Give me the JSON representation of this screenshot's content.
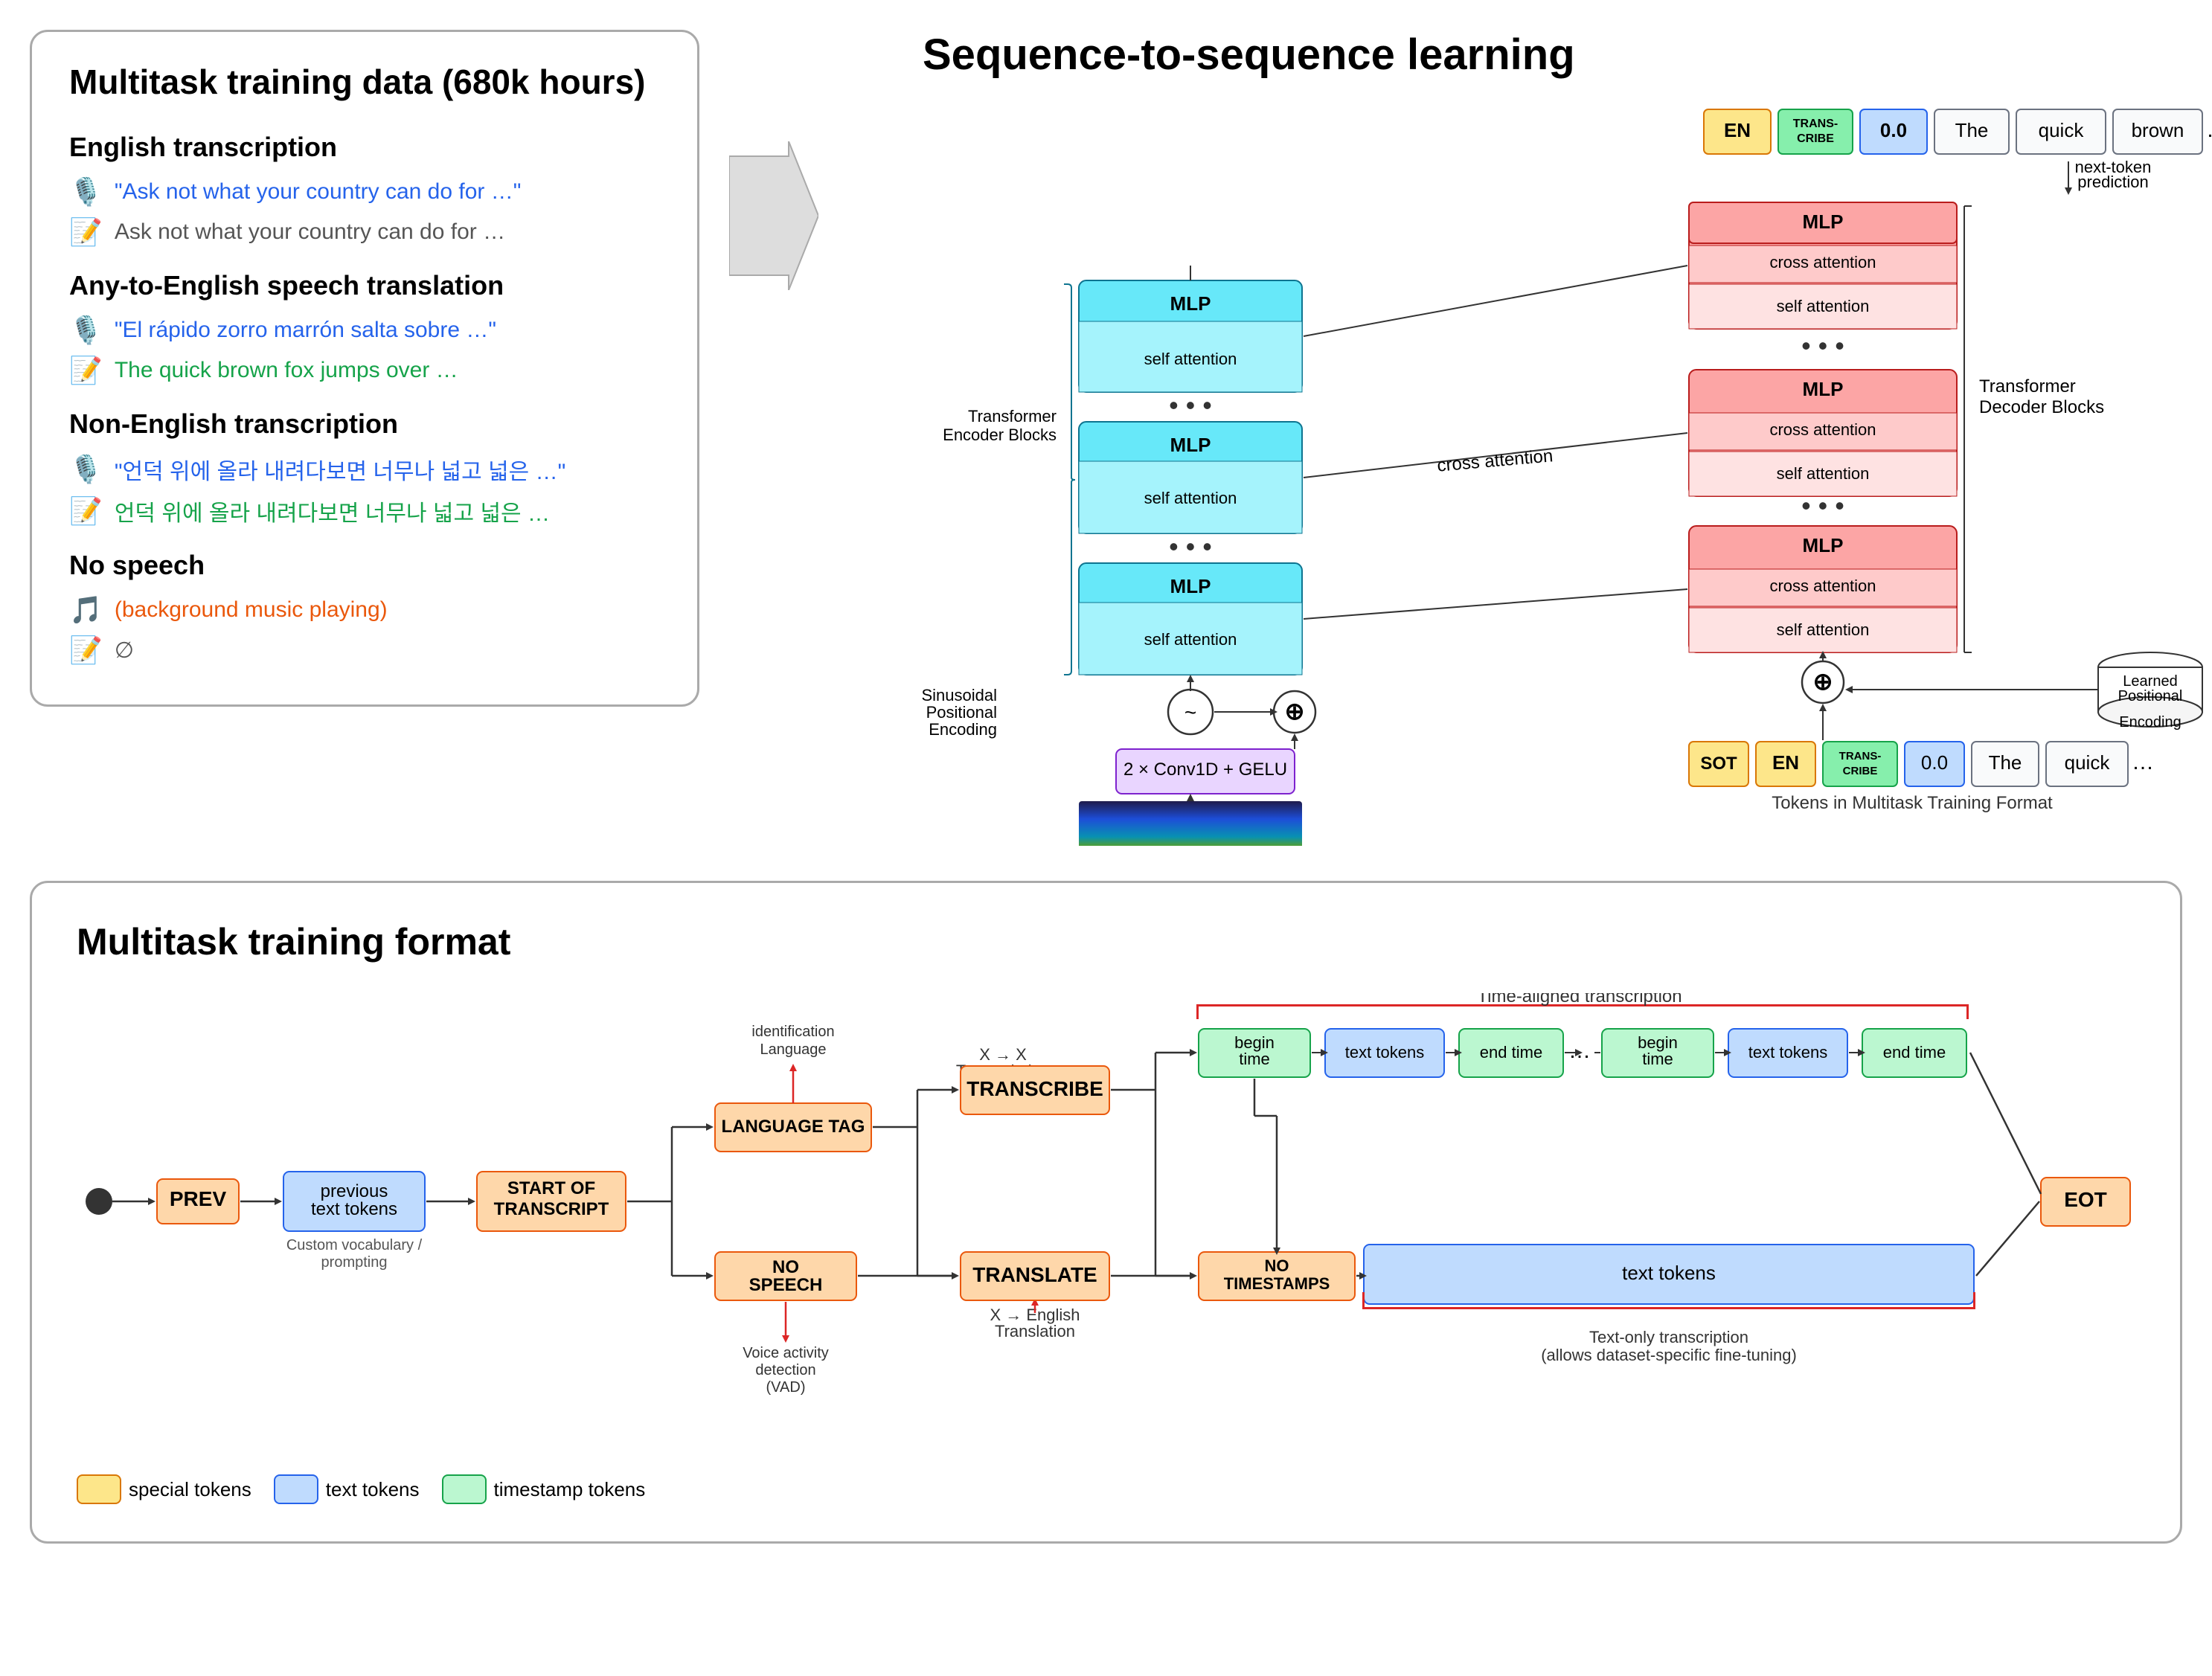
{
  "top_left": {
    "title": "Multitask training data (680k hours)",
    "sections": [
      {
        "title": "English transcription",
        "items": [
          {
            "icon": "🎙️",
            "text": "\"Ask not what your country can do for …\"",
            "color": "blue"
          },
          {
            "icon": "📝",
            "text": "Ask not what your country can do for …",
            "color": "gray"
          }
        ]
      },
      {
        "title": "Any-to-English speech translation",
        "items": [
          {
            "icon": "🎙️",
            "text": "\"El rápido zorro marrón salta sobre …\"",
            "color": "blue"
          },
          {
            "icon": "📝",
            "text": "The quick brown fox jumps over …",
            "color": "green"
          }
        ]
      },
      {
        "title": "Non-English transcription",
        "items": [
          {
            "icon": "🎙️",
            "text": "\"언덕 위에 올라 내려다보면 너무나 넓고 넓은 …\"",
            "color": "blue"
          },
          {
            "icon": "📝",
            "text": "언덕 위에 올라 내려다보면 너무나 넓고 넓은 …",
            "color": "green"
          }
        ]
      },
      {
        "title": "No speech",
        "items": [
          {
            "icon": "🎵",
            "text": "(background music playing)",
            "color": "orange"
          },
          {
            "icon": "📝",
            "text": "∅",
            "color": "gray"
          }
        ]
      }
    ]
  },
  "seq2seq": {
    "title": "Sequence-to-sequence learning",
    "encoder_label": "Transformer\nEncoder Blocks",
    "sinusoidal_label": "Sinusoidal\nPositional\nEncoding",
    "conv_label": "2 × Conv1D + GELU",
    "spectrogram_label": "Log-Mel Spectrogram",
    "cross_attention_label": "cross attention",
    "decoder_label": "Transformer\nDecoder Blocks",
    "learned_pe_label": "Learned\nPositional\nEncoding",
    "next_token_label": "next-token\nprediction",
    "tokens_label": "Tokens in Multitask Training Format",
    "output_tokens": [
      "EN",
      "TRANS-\nCRIBE",
      "0.0",
      "The",
      "quick",
      "brown",
      "…"
    ],
    "input_tokens": [
      "SOT",
      "EN",
      "TRANS-\nCRIBE",
      "0.0",
      "The",
      "quick",
      "…"
    ],
    "encoder_blocks": [
      {
        "mlp": "MLP",
        "attn": "self attention"
      },
      {
        "mlp": "MLP",
        "attn": "self attention"
      },
      {
        "mlp": "MLP",
        "attn": "self attention"
      }
    ],
    "decoder_blocks": [
      {
        "mlp": "MLP",
        "cross": "cross attention",
        "self": "self attention"
      },
      {
        "mlp": "MLP",
        "cross": "cross attention",
        "self": "self attention"
      },
      {
        "mlp": "MLP",
        "cross": "cross attention",
        "self": "self attention"
      }
    ]
  },
  "bottom": {
    "title": "Multitask training format",
    "nodes": {
      "prev": "PREV",
      "previous_text": "previous\ntext tokens",
      "start_of_transcript": "START OF\nTRANSCRIPT",
      "language_tag": "LANGUAGE TAG",
      "no_speech": "NO\nSPEECH",
      "transcribe": "TRANSCRIBE",
      "translate": "TRANSLATE",
      "no_timestamps": "NO\nTIMESTAMPS",
      "begin_time": "begin\ntime",
      "text_tokens": "text tokens",
      "end_time": "end time",
      "text_tokens_large": "text tokens",
      "eot": "EOT"
    },
    "labels": {
      "custom_vocab": "Custom vocabulary /\nprompting",
      "language_id": "Language\nidentification",
      "voice_activity": "Voice activity\ndetection\n(VAD)",
      "x_to_x": "X → X\nTranscription",
      "x_to_english": "X → English\nTranslation",
      "time_aligned": "Time-aligned transcription",
      "text_only": "Text-only transcription\n(allows dataset-specific fine-tuning)"
    },
    "legend": [
      {
        "label": "special tokens",
        "color": "#fde68a",
        "border": "#d97706"
      },
      {
        "label": "text tokens",
        "color": "#bfdbfe",
        "border": "#2563eb"
      },
      {
        "label": "timestamp tokens",
        "color": "#bbf7d0",
        "border": "#16a34a"
      }
    ]
  }
}
